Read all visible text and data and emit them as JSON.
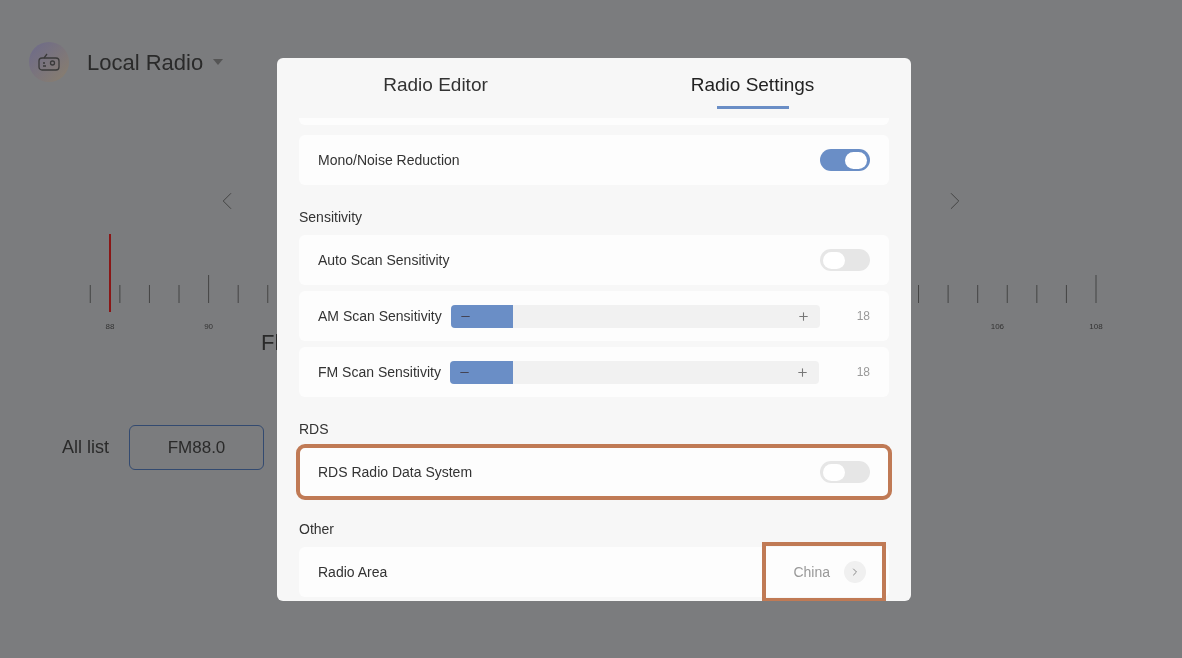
{
  "header": {
    "title": "Local Radio"
  },
  "dial": {
    "labels": [
      "88",
      "90",
      "106",
      "108"
    ]
  },
  "frequency_fragment": "Fl",
  "station_list": {
    "label": "All list",
    "stations": [
      {
        "name": "FM88.0",
        "selected": true
      }
    ]
  },
  "dialog": {
    "tabs": [
      {
        "label": "Radio Editor",
        "selected": false
      },
      {
        "label": "Radio Settings",
        "selected": true
      }
    ],
    "sections": [
      {
        "rows": [
          {
            "kind": "toggle",
            "label": "Mono/Noise Reduction",
            "on": true,
            "highlighted": false
          }
        ]
      },
      {
        "title": "Sensitivity",
        "rows": [
          {
            "kind": "toggle",
            "label": "Auto Scan Sensitivity",
            "on": false,
            "highlighted": false
          },
          {
            "kind": "slider",
            "label": "AM Scan Sensitivity",
            "level": 0.17,
            "reading": "18",
            "highlighted": false
          },
          {
            "kind": "slider",
            "label": "FM Scan Sensitivity",
            "level": 0.17,
            "reading": "18",
            "highlighted": false
          }
        ]
      },
      {
        "title": "RDS",
        "rows": [
          {
            "kind": "toggle",
            "label": "RDS Radio Data System",
            "on": false,
            "highlighted": true
          }
        ]
      },
      {
        "title": "Other",
        "rows": [
          {
            "kind": "link",
            "label": "Radio Area",
            "value": "China",
            "highlighted": false,
            "value_highlighted": true
          }
        ]
      }
    ]
  }
}
